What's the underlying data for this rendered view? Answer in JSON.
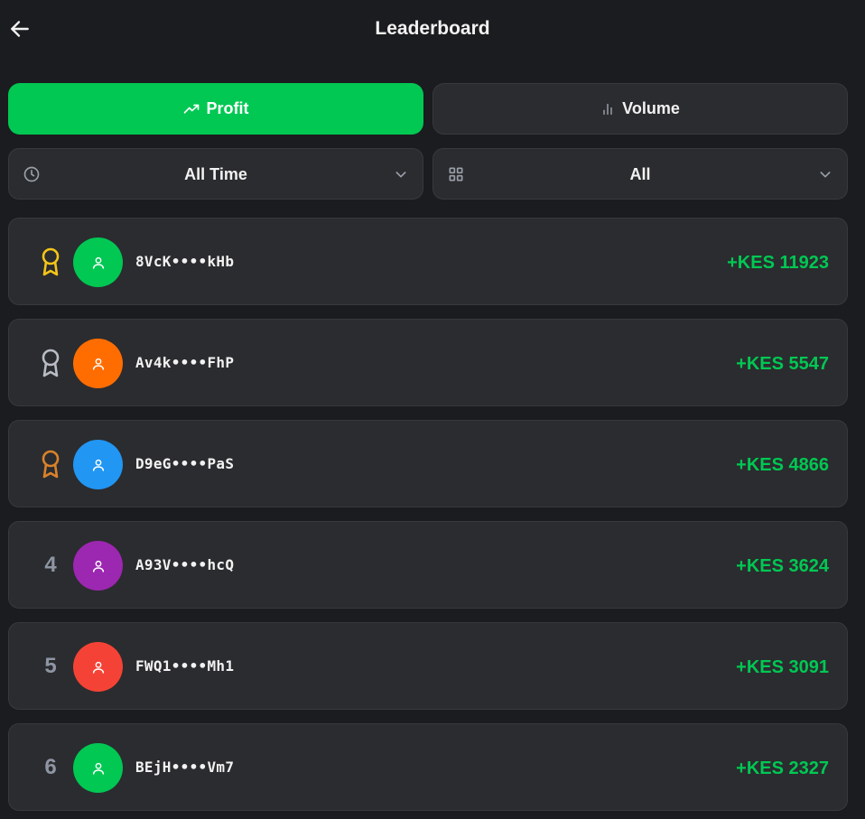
{
  "header": {
    "title": "Leaderboard",
    "back_icon": "arrow-left-icon"
  },
  "tabs": [
    {
      "label": "Profit",
      "icon": "trending-up-icon",
      "active": true
    },
    {
      "label": "Volume",
      "icon": "bar-chart-icon",
      "active": false
    }
  ],
  "filters": {
    "time": {
      "label": "All Time",
      "icon": "clock-icon"
    },
    "category": {
      "label": "All",
      "icon": "grid-icon"
    }
  },
  "colors": {
    "accent": "#00c853",
    "gold": "#f5c518",
    "silver": "#b8bcc4",
    "bronze": "#d9822b"
  },
  "leaders": [
    {
      "rank": "1",
      "medal": "gold",
      "username": "8VcK••••kHb",
      "amount": "+KES 11923",
      "avatar_color": "#00c853"
    },
    {
      "rank": "2",
      "medal": "silver",
      "username": "Av4k••••FhP",
      "amount": "+KES 5547",
      "avatar_color": "#ff6d00"
    },
    {
      "rank": "3",
      "medal": "bronze",
      "username": "D9eG••••PaS",
      "amount": "+KES 4866",
      "avatar_color": "#2196f3"
    },
    {
      "rank": "4",
      "medal": "",
      "username": "A93V••••hcQ",
      "amount": "+KES 3624",
      "avatar_color": "#9c27b0"
    },
    {
      "rank": "5",
      "medal": "",
      "username": "FWQ1••••Mh1",
      "amount": "+KES 3091",
      "avatar_color": "#f44336"
    },
    {
      "rank": "6",
      "medal": "",
      "username": "BEjH••••Vm7",
      "amount": "+KES 2327",
      "avatar_color": "#00c853"
    }
  ]
}
